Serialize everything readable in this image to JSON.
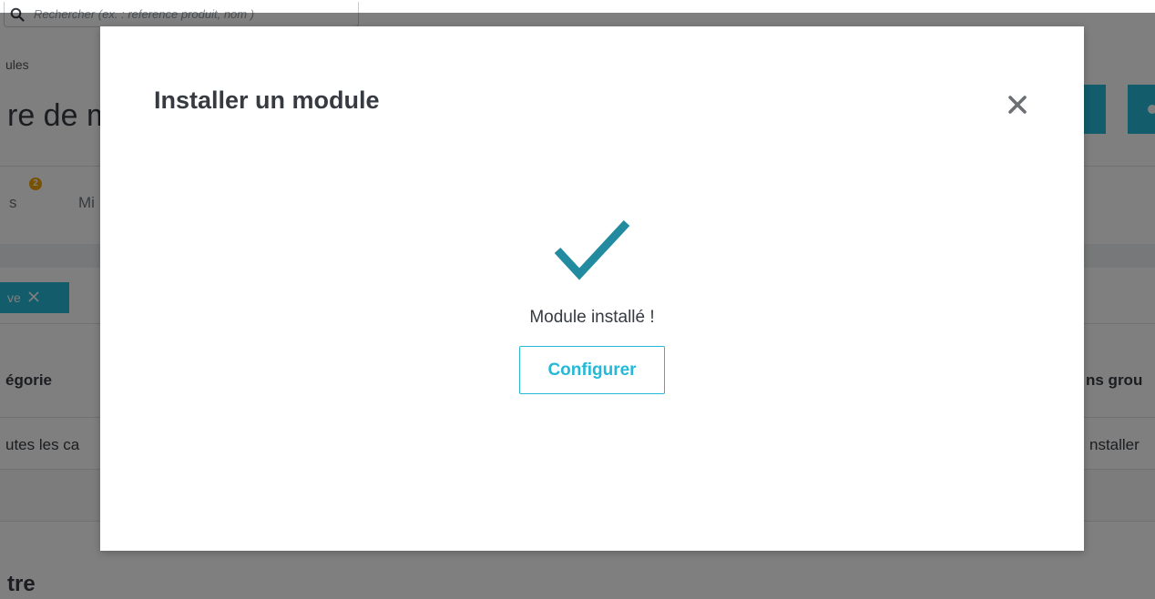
{
  "background": {
    "search_placeholder": "Rechercher (ex. : reference produit, nom )",
    "breadcrumb": "ules",
    "page_title": "re de m",
    "tabs": [
      {
        "label": "s",
        "badge": "2"
      },
      {
        "label": "Mi"
      }
    ],
    "filter_chip": "ve",
    "columns": {
      "category": "égorie",
      "right": "ns grou"
    },
    "cells": {
      "category": "utes les ca",
      "right": "nstaller"
    },
    "bottom_title": "tre",
    "accent_color": "#25b9d7",
    "badge_color": "#f0a500"
  },
  "modal": {
    "title": "Installer un module",
    "close_icon": "close-icon",
    "status_icon": "checkmark-icon",
    "message": "Module installé !",
    "configure_label": "Configurer",
    "accent_color": "#25b9d7",
    "check_color": "#238b9f"
  }
}
